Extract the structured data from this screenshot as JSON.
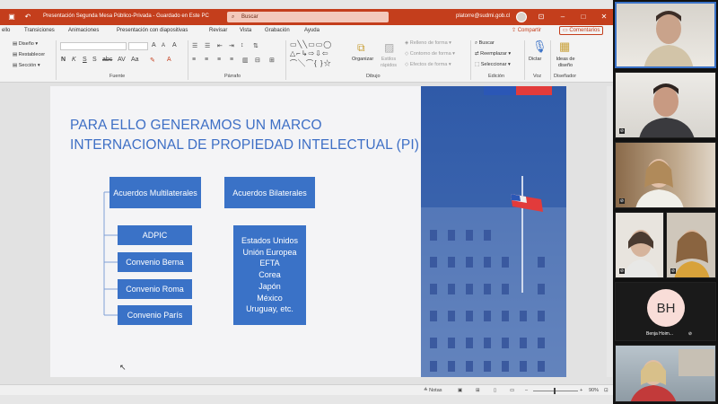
{
  "titlebar": {
    "title": "Presentación Segunda Mesa Público-Privada  -  Guardado en Este PC",
    "search_placeholder": "Buscar",
    "user_email": "platorre@sudmi.gob.cl"
  },
  "menu": {
    "items": [
      "ello",
      "Transiciones",
      "Animaciones",
      "Presentación con diapositivas",
      "Revisar",
      "Vista",
      "Grabación",
      "Ayuda"
    ],
    "share_label": "Compartir",
    "comments_label": "Comentarios"
  },
  "ribbon": {
    "diseno": "Diseño",
    "restablecer": "Restablecer",
    "seccion": "Sección",
    "organizar": "Organizar",
    "estilos_rapidos": "Estilos rápidos",
    "relleno": "Relleno de forma",
    "contorno": "Contorno de forma",
    "efectos": "Efectos de forma",
    "buscar": "Buscar",
    "reemplazar": "Reemplazar",
    "seleccionar": "Seleccionar",
    "dictar": "Dictar",
    "ideas": "Ideas de diseño",
    "groups": {
      "fuente": "Fuente",
      "parrafo": "Párrafo",
      "dibujo": "Dibujo",
      "edicion": "Edición",
      "voz": "Voz",
      "disenador": "Diseñador"
    }
  },
  "slide": {
    "title_line1": "PARA ELLO GENERAMOS UN MARCO",
    "title_line2": "INTERNACIONAL DE PROPIEDAD INTELECTUAL (PI)",
    "multilateral_heading": "Acuerdos Multilaterales",
    "bilateral_heading": "Acuerdos Bilaterales",
    "multilateral_items": [
      "ADPIC",
      "Convenio Berna",
      "Convenio Roma",
      "Convenio París"
    ],
    "bilateral_list": [
      "Estados Unidos",
      "Unión Europea",
      "EFTA",
      "Corea",
      "Japón",
      "México",
      "Uruguay, etc."
    ],
    "accent_blue": "#3a72c7",
    "title_blue": "#3e6fc5"
  },
  "statusbar": {
    "notes": "Notas",
    "zoom": "90%"
  },
  "participants": {
    "initials": "BH",
    "name": "Benja Hoim..."
  },
  "colors": {
    "ppt_red": "#c43e1c",
    "flag_blue": "#2b57b6",
    "flag_red": "#e23b3b"
  }
}
